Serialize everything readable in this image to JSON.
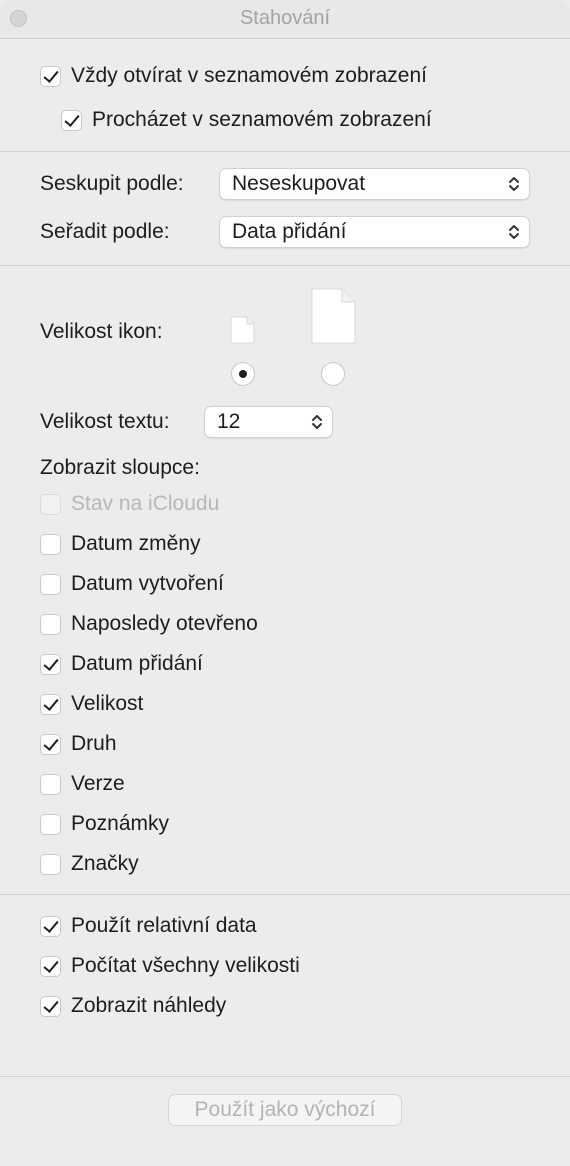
{
  "window": {
    "title": "Stahování"
  },
  "top_options": [
    {
      "label": "Vždy otvírat v seznamovém zobrazení",
      "checked": true
    },
    {
      "label": "Procházet v seznamovém zobrazení",
      "checked": true
    }
  ],
  "group_by": {
    "label": "Seskupit podle:",
    "value": "Neseskupovat"
  },
  "sort_by": {
    "label": "Seřadit podle:",
    "value": "Data přidání"
  },
  "icon_size": {
    "label": "Velikost ikon:",
    "selected": "small"
  },
  "text_size": {
    "label": "Velikost textu:",
    "value": "12"
  },
  "columns": {
    "label": "Zobrazit sloupce:",
    "items": [
      {
        "label": "Stav na iCloudu",
        "checked": false,
        "disabled": true
      },
      {
        "label": "Datum změny",
        "checked": false
      },
      {
        "label": "Datum vytvoření",
        "checked": false
      },
      {
        "label": "Naposledy otevřeno",
        "checked": false
      },
      {
        "label": "Datum přidání",
        "checked": true
      },
      {
        "label": "Velikost",
        "checked": true
      },
      {
        "label": "Druh",
        "checked": true
      },
      {
        "label": "Verze",
        "checked": false
      },
      {
        "label": "Poznámky",
        "checked": false
      },
      {
        "label": "Značky",
        "checked": false
      }
    ]
  },
  "bottom_options": [
    {
      "label": "Použít relativní data",
      "checked": true
    },
    {
      "label": "Počítat všechny velikosti",
      "checked": true
    },
    {
      "label": "Zobrazit náhledy",
      "checked": true
    }
  ],
  "default_button": {
    "label": "Použít jako výchozí",
    "enabled": false
  }
}
